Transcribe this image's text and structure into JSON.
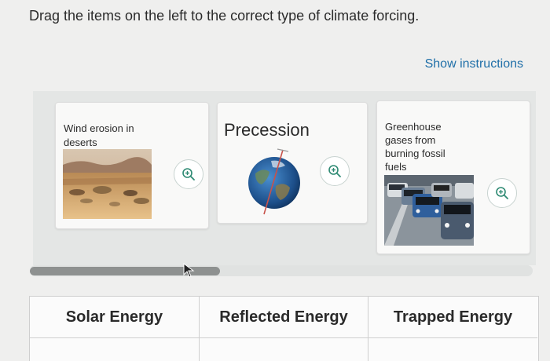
{
  "question": "Drag the items on the left to the correct type of climate forcing.",
  "show_instructions": "Show instructions",
  "cards": {
    "wind_erosion": {
      "label": "Wind erosion in deserts",
      "zoom_icon": "zoom-in-icon"
    },
    "precession": {
      "label": "Precession",
      "zoom_icon": "zoom-in-icon"
    },
    "greenhouse": {
      "label": "Greenhouse gases from burning fossil fuels",
      "zoom_icon": "zoom-in-icon"
    }
  },
  "scrollbar": {
    "position": 0.0
  },
  "columns": [
    "Solar Energy",
    "Reflected Energy",
    "Trapped Energy"
  ],
  "colors": {
    "link": "#1f6fa8",
    "zoom_border": "#c8d3d0",
    "zoom_icon": "#2e8a73"
  }
}
